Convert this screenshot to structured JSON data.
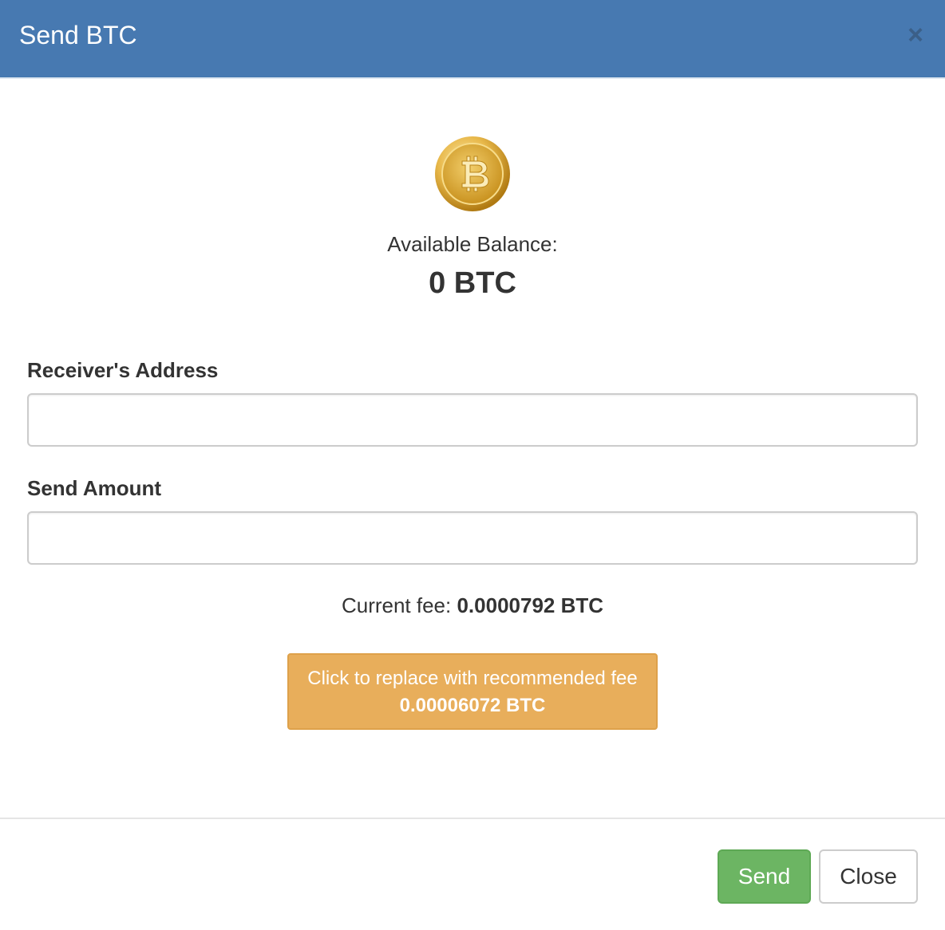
{
  "modal": {
    "title": "Send BTC",
    "close_symbol": "×"
  },
  "coin": {
    "icon": "bitcoin-coin-icon",
    "colors": {
      "gold_light": "#f4d27a",
      "gold_dark": "#c8901c",
      "symbol": "#f7e6a8"
    }
  },
  "balance": {
    "label": "Available Balance:",
    "value": "0 BTC"
  },
  "form": {
    "address_label": "Receiver's Address",
    "address_value": "",
    "amount_label": "Send Amount",
    "amount_value": ""
  },
  "fee": {
    "prefix": "Current fee: ",
    "value": "0.0000792 BTC",
    "recommend_line1": "Click to replace with recommended fee",
    "recommend_line2": "0.00006072 BTC"
  },
  "footer": {
    "send_label": "Send",
    "close_label": "Close"
  },
  "colors": {
    "header": "#4779b1",
    "warning": "#e8ae5b",
    "success": "#6cb563"
  }
}
